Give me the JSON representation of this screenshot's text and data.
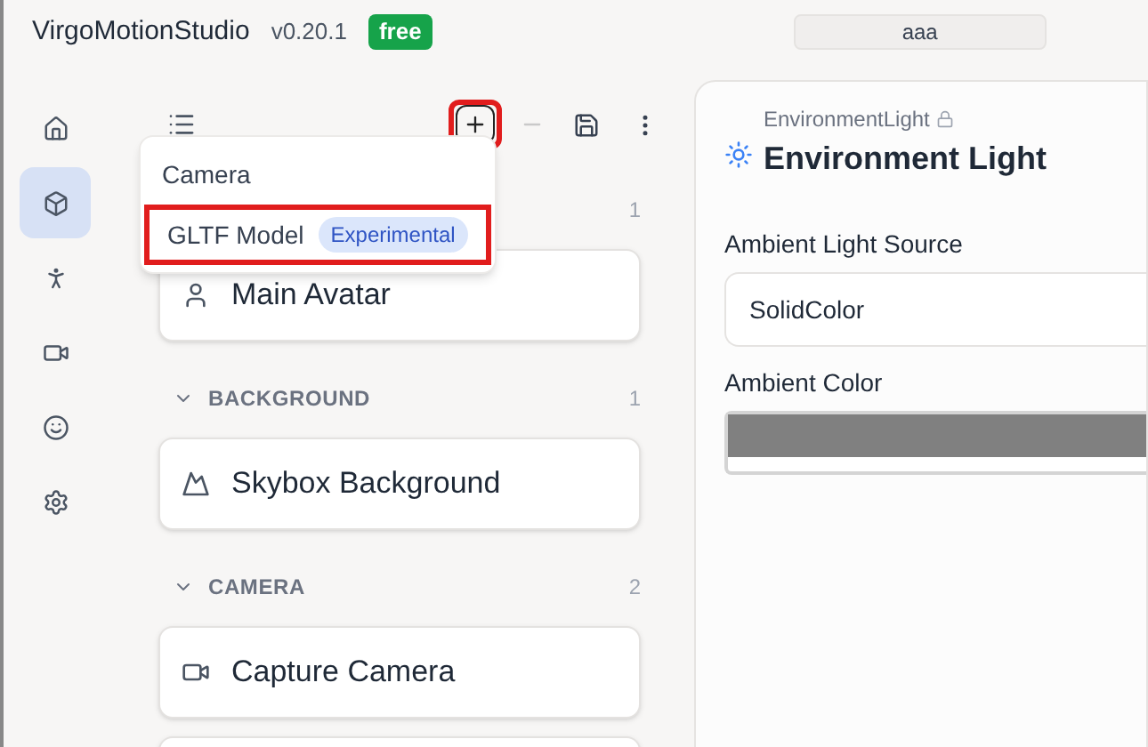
{
  "app": {
    "name": "VirgoMotionStudio",
    "version": "v0.20.1",
    "badge": "free",
    "field_value": "aaa"
  },
  "rail": [
    {
      "selected": false
    },
    {
      "selected": true
    },
    {
      "selected": false
    },
    {
      "selected": false
    },
    {
      "selected": false
    },
    {
      "selected": false
    }
  ],
  "toolbar": {
    "add_highlighted": true
  },
  "add_menu": [
    {
      "label": "Camera",
      "highlighted": false
    },
    {
      "label": "GLTF Model",
      "tag": "Experimental",
      "highlighted": true
    }
  ],
  "sections": [
    {
      "count": "1",
      "items": [
        {
          "kind": "avatar",
          "label": "Main Avatar"
        }
      ]
    },
    {
      "title": "BACKGROUND",
      "count": "1",
      "items": [
        {
          "kind": "background",
          "label": "Skybox Background"
        }
      ]
    },
    {
      "title": "CAMERA",
      "count": "2",
      "items": [
        {
          "kind": "camera",
          "label": "Capture Camera"
        },
        {
          "kind": "blank"
        }
      ]
    }
  ],
  "inspector": {
    "type": "EnvironmentLight",
    "locked": true,
    "title": "Environment Light",
    "fields": [
      {
        "kind": "select",
        "label": "Ambient Light Source",
        "value": "SolidColor"
      },
      {
        "kind": "color",
        "label": "Ambient Color",
        "color": "#808080"
      }
    ]
  }
}
